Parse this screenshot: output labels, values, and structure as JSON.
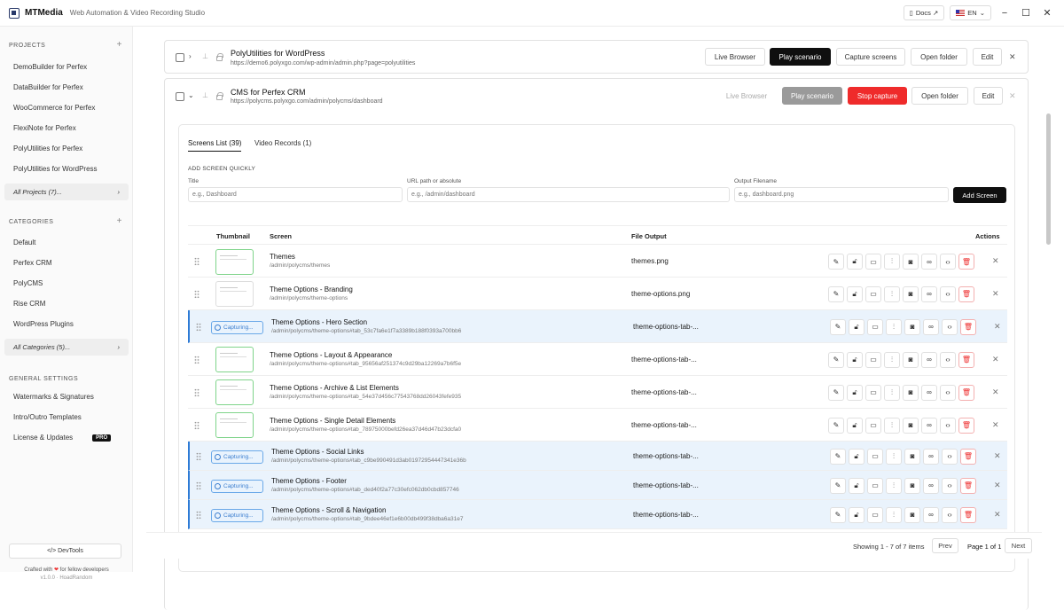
{
  "app": {
    "name": "MTMedia",
    "subtitle": "Web Automation & Video Recording Studio"
  },
  "titlebar": {
    "docs_label": "Docs ↗",
    "lang_label": "EN"
  },
  "sidebar": {
    "projects_heading": "PROJECTS",
    "projects": [
      "DemoBuilder for Perfex",
      "DataBuilder for Perfex",
      "WooCommerce for Perfex",
      "FlexiNote for Perfex",
      "PolyUtilities for Perfex",
      "PolyUtilities for WordPress"
    ],
    "all_projects": "All Projects (7)...",
    "categories_heading": "CATEGORIES",
    "categories": [
      "Default",
      "Perfex CRM",
      "PolyCMS",
      "Rise CRM",
      "WordPress Plugins"
    ],
    "all_categories": "All Categories (5)...",
    "settings_heading": "GENERAL SETTINGS",
    "settings": [
      "Watermarks & Signatures",
      "Intro/Outro Templates",
      "License & Updates"
    ],
    "pro_badge": "PRO",
    "devtools_label": "</> DevTools",
    "crafted_text": "Crafted with",
    "crafted_suffix": "for fellow developers",
    "version": "v1.0.0 · HoadRandom"
  },
  "projects": [
    {
      "name": "PolyUtilities for WordPress",
      "url": "https://demo6.polyxgo.com/wp-admin/admin.php?page=polyutilities",
      "live_browser": "Live Browser",
      "play": "Play scenario",
      "capture": "Capture screens",
      "open_folder": "Open folder",
      "edit": "Edit"
    },
    {
      "name": "CMS for Perfex CRM",
      "url": "https://polycms.polyxgo.com/admin/polycms/dashboard",
      "live_browser": "Live Browser",
      "play": "Play scenario",
      "stop": "Stop capture",
      "open_folder": "Open folder",
      "edit": "Edit"
    }
  ],
  "panel": {
    "tab_screens": "Screens List (39)",
    "tab_videos": "Video Records (1)",
    "quick_heading": "ADD SCREEN QUICKLY",
    "title_label": "Title",
    "title_placeholder": "e.g., Dashboard",
    "url_label": "URL path or absolute",
    "url_placeholder": "e.g., /admin/dashboard",
    "output_label": "Output Filename",
    "output_placeholder": "e.g., dashboard.png",
    "add_button": "Add Screen",
    "col_thumbnail": "Thumbnail",
    "col_screen": "Screen",
    "col_output": "File Output",
    "col_actions": "Actions",
    "capturing_label": "Capturing..."
  },
  "rows": [
    {
      "name": "Themes",
      "path": "/admin/polycms/themes",
      "output": "themes.png",
      "state": "done"
    },
    {
      "name": "Theme Options - Branding",
      "path": "/admin/polycms/theme-options",
      "output": "theme-options.png",
      "state": "plain"
    },
    {
      "name": "Theme Options - Hero Section",
      "path": "/admin/polycms/theme-options#tab_53c7fa6e1f7a3389b188f0393a700bb6",
      "output": "theme-options-tab-...",
      "state": "capturing"
    },
    {
      "name": "Theme Options - Layout & Appearance",
      "path": "/admin/polycms/theme-options#tab_95656af251374c9d29ba12269a7b6f5e",
      "output": "theme-options-tab-...",
      "state": "done"
    },
    {
      "name": "Theme Options - Archive & List Elements",
      "path": "/admin/polycms/theme-options#tab_54e37d456c77543768dd26043fefe935",
      "output": "theme-options-tab-...",
      "state": "done"
    },
    {
      "name": "Theme Options - Single Detail Elements",
      "path": "/admin/polycms/theme-options#tab_78975000befd26ea37d46d47b23dcfa0",
      "output": "theme-options-tab-...",
      "state": "done"
    },
    {
      "name": "Theme Options - Social Links",
      "path": "/admin/polycms/theme-options#tab_c9be990491d3ab01972954447341e36b",
      "output": "theme-options-tab-...",
      "state": "capturing"
    },
    {
      "name": "Theme Options - Footer",
      "path": "/admin/polycms/theme-options#tab_ded40f2a77c30efc062db0cbd857746",
      "output": "theme-options-tab-...",
      "state": "capturing"
    },
    {
      "name": "Theme Options - Scroll & Navigation",
      "path": "/admin/polycms/theme-options#tab_9bdee46ef1e6b00db499f38dba6a31e7",
      "output": "theme-options-tab-...",
      "state": "capturing"
    }
  ],
  "pagination": {
    "info": "Showing 1 - 7 of 7 items",
    "prev": "Prev",
    "page": "Page 1 of 1",
    "next": "Next"
  },
  "colors": {
    "accent": "#2e7bd6",
    "stop": "#ef2b2b",
    "done_thumb": "#7fd48a"
  }
}
